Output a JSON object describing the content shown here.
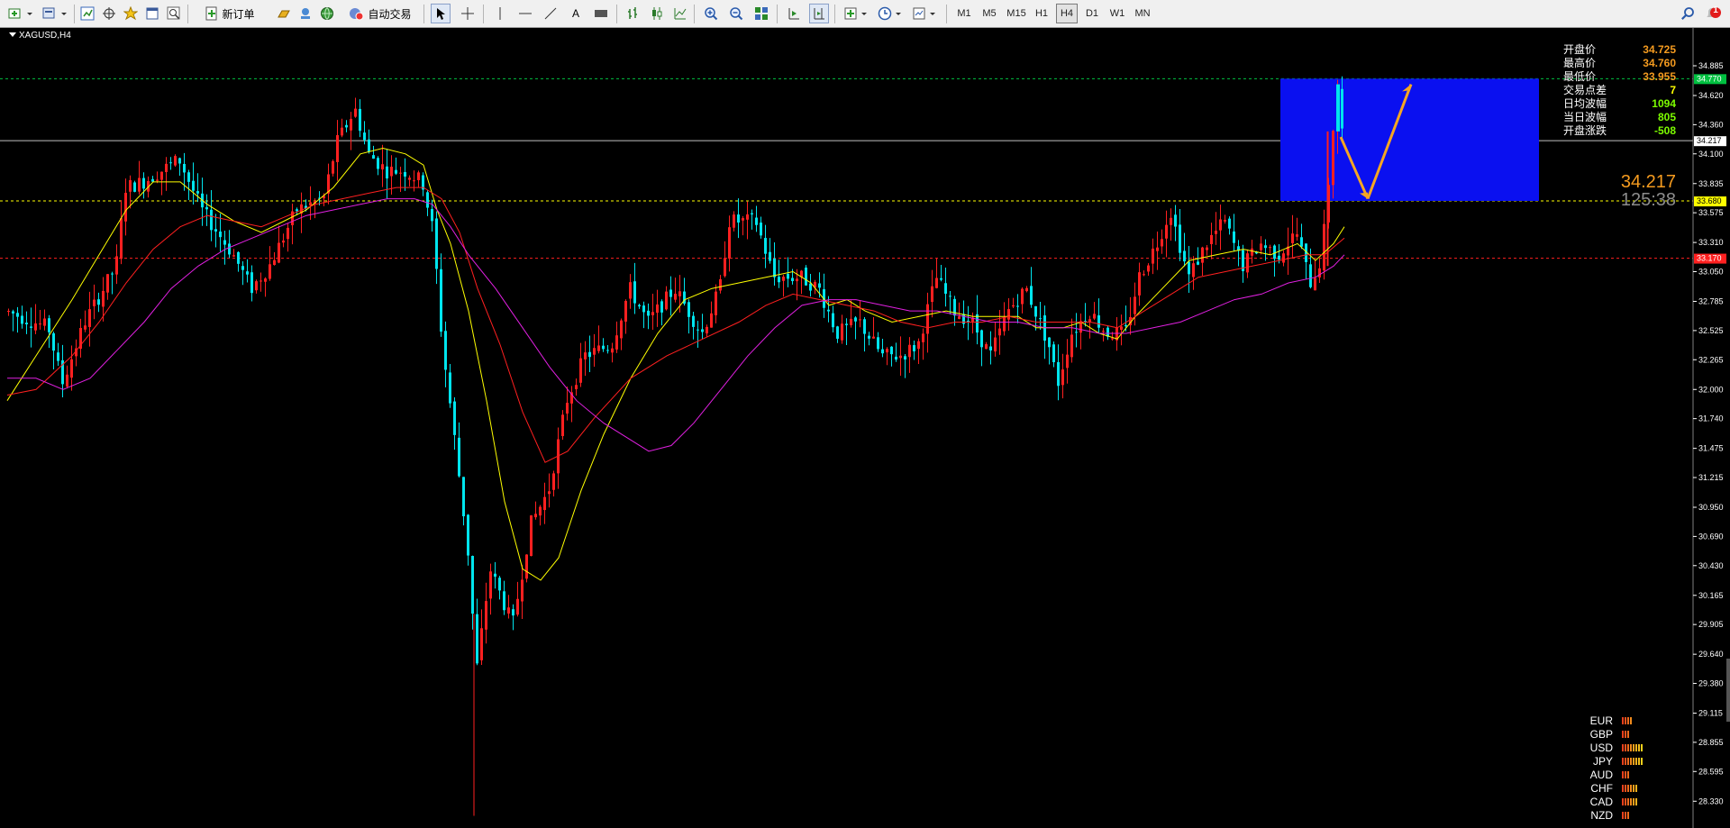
{
  "toolbar": {
    "new_order_label": "新订单",
    "auto_trade_label": "自动交易",
    "text_tool_label": "A",
    "timeframes": [
      "M1",
      "M5",
      "M15",
      "H1",
      "H4",
      "D1",
      "W1",
      "MN"
    ],
    "active_timeframe": "H4",
    "notification_count": "1"
  },
  "chart": {
    "symbol_label": "XAGUSD,H4",
    "colors": {
      "bull": "#ff2020",
      "bear": "#00e5ee",
      "ma_fast": "#ffff00",
      "ma_mid": "#ff2020",
      "ma_slow": "#e020e0",
      "box": "#0a10f0",
      "arrow": "#f5a623"
    },
    "price_axis": [
      "34.885",
      "34.620",
      "34.360",
      "34.100",
      "33.835",
      "33.575",
      "33.310",
      "33.050",
      "32.785",
      "32.525",
      "32.265",
      "32.000",
      "31.740",
      "31.475",
      "31.215",
      "30.950",
      "30.690",
      "30.430",
      "30.165",
      "29.905",
      "29.640",
      "29.380",
      "29.115",
      "28.855",
      "28.595",
      "28.330"
    ],
    "lines": [
      {
        "name": "high-line",
        "price": "34.770",
        "color": "#00c040",
        "tag_bg": "#00c040",
        "tag_fg": "#fff"
      },
      {
        "name": "current-line",
        "price": "34.217",
        "color": "#c0c0c0",
        "tag_bg": "#ffffff",
        "tag_fg": "#000"
      },
      {
        "name": "support-line",
        "price": "33.680",
        "color": "#ffff00",
        "tag_bg": "#ffff00",
        "tag_fg": "#000"
      },
      {
        "name": "red-line",
        "price": "33.170",
        "color": "#ff2020",
        "tag_bg": "#ff2020",
        "tag_fg": "#fff"
      }
    ]
  },
  "info_panel": [
    {
      "label": "开盘价",
      "value": "34.725",
      "color": "#f59b1f"
    },
    {
      "label": "最高价",
      "value": "34.760",
      "color": "#f59b1f"
    },
    {
      "label": "最低价",
      "value": "33.955",
      "color": "#f59b1f"
    },
    {
      "label": "交易点差",
      "value": "7",
      "color": "#ffff00"
    },
    {
      "label": "日均波幅",
      "value": "1094",
      "color": "#7cfc00"
    },
    {
      "label": "当日波幅",
      "value": "805",
      "color": "#7cfc00"
    },
    {
      "label": "开盘涨跌",
      "value": "-508",
      "color": "#7cfc00"
    }
  ],
  "current_price": "34.217",
  "countdown": "125:38",
  "currency_strength": [
    {
      "name": "EUR",
      "bars": 4
    },
    {
      "name": "GBP",
      "bars": 3
    },
    {
      "name": "USD",
      "bars": 8
    },
    {
      "name": "JPY",
      "bars": 8
    },
    {
      "name": "AUD",
      "bars": 3
    },
    {
      "name": "CHF",
      "bars": 6
    },
    {
      "name": "CAD",
      "bars": 6
    },
    {
      "name": "NZD",
      "bars": 3
    }
  ]
}
